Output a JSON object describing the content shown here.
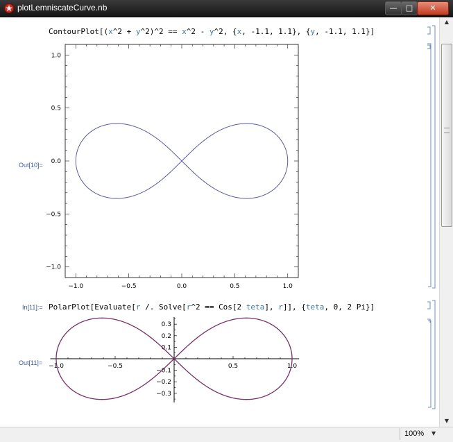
{
  "window": {
    "title": "plotLemniscateCurve.nb"
  },
  "cell1": {
    "code": [
      {
        "t": "ContourPlot[(",
        "c": ""
      },
      {
        "t": "x",
        "c": "v"
      },
      {
        "t": "^2 + ",
        "c": ""
      },
      {
        "t": "y",
        "c": "v"
      },
      {
        "t": "^2)^2 == ",
        "c": ""
      },
      {
        "t": "x",
        "c": "v"
      },
      {
        "t": "^2 - ",
        "c": ""
      },
      {
        "t": "y",
        "c": "v"
      },
      {
        "t": "^2, {",
        "c": ""
      },
      {
        "t": "x",
        "c": "v"
      },
      {
        "t": ", -1.1, 1.1}, {",
        "c": ""
      },
      {
        "t": "y",
        "c": "v"
      },
      {
        "t": ", -1.1, 1.1}]",
        "c": ""
      }
    ],
    "out_label": "Out[10]="
  },
  "cell2": {
    "in_label": "In[11]:=",
    "code": [
      {
        "t": "PolarPlot[Evaluate[",
        "c": ""
      },
      {
        "t": "r",
        "c": "v"
      },
      {
        "t": " /. Solve[",
        "c": ""
      },
      {
        "t": "r",
        "c": "v"
      },
      {
        "t": "^2 == Cos[2 ",
        "c": ""
      },
      {
        "t": "teta",
        "c": "v"
      },
      {
        "t": "], ",
        "c": ""
      },
      {
        "t": "r",
        "c": "v"
      },
      {
        "t": "]], {",
        "c": ""
      },
      {
        "t": "teta",
        "c": "v"
      },
      {
        "t": ", 0, 2 Pi}]",
        "c": ""
      }
    ],
    "out_label": "Out[11]="
  },
  "colors": {
    "contour": "#5a5aa5",
    "polar": "#7a2f6a",
    "label": "#3a57a8",
    "var": "#3a7a9a"
  },
  "chart_data": [
    {
      "type": "line",
      "name": "contour-plot",
      "equation": "(x^2 + y^2)^2 == x^2 - y^2",
      "xlim": [
        -1.1,
        1.1
      ],
      "ylim": [
        -1.1,
        1.1
      ],
      "xticks": [
        -1.0,
        -0.5,
        0.0,
        0.5,
        1.0
      ],
      "yticks": [
        -1.0,
        -0.5,
        0.0,
        0.5,
        1.0
      ],
      "xtick_labels": [
        "−1.0",
        "−0.5",
        "0.0",
        "0.5",
        "1.0"
      ],
      "ytick_labels": [
        "−1.0",
        "−0.5",
        "0.0",
        "0.5",
        "1.0"
      ],
      "frame": true,
      "grid": false
    },
    {
      "type": "line",
      "name": "polar-plot",
      "equation": "r^2 == Cos[2 teta], teta in [0, 2 Pi]",
      "xlim": [
        -1.0,
        1.0
      ],
      "ylim": [
        -0.36,
        0.36
      ],
      "xticks": [
        -1.0,
        -0.5,
        0.5,
        1.0
      ],
      "yticks": [
        -0.3,
        -0.2,
        -0.1,
        0.1,
        0.2,
        0.3
      ],
      "xtick_labels": [
        "−1.0",
        "−0.5",
        "0.5",
        "1.0"
      ],
      "ytick_labels": [
        "−0.3",
        "−0.2",
        "−0.1",
        "0.1",
        "0.2",
        "0.3"
      ],
      "axes_through_origin": true,
      "grid": false
    }
  ],
  "status": {
    "zoom": "100%"
  }
}
